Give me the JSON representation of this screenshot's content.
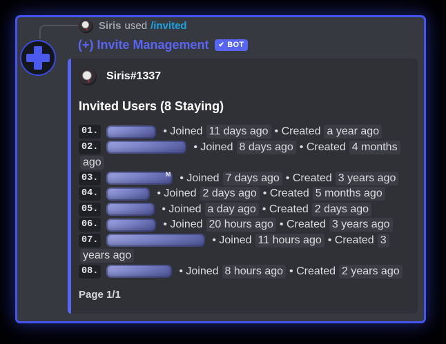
{
  "reply": {
    "username": "Siris",
    "action": "used",
    "command": "/invited"
  },
  "message": {
    "author": "(+) Invite Management",
    "bot_check": "✔",
    "bot_badge": "BOT"
  },
  "embed": {
    "author": "Siris#1337",
    "title": "Invited Users (8 Staying)",
    "footer": "Page 1/1",
    "entries": [
      {
        "num": "01.",
        "pill_width": 72,
        "fragment": "",
        "rows": [
          [
            {
              "t": "txt",
              "v": "• Joined"
            },
            {
              "t": "chip",
              "v": "11 days ago"
            },
            {
              "t": "txt",
              "v": "• Created"
            },
            {
              "t": "chip",
              "v": "a year ago"
            }
          ]
        ]
      },
      {
        "num": "02.",
        "pill_width": 116,
        "fragment": "",
        "rows": [
          [
            {
              "t": "txt",
              "v": "• Joined"
            },
            {
              "t": "chip",
              "v": "8 days ago"
            },
            {
              "t": "txt",
              "v": "• Created"
            },
            {
              "t": "chip",
              "v": "4 months"
            }
          ],
          [
            {
              "t": "chip",
              "v": "ago"
            }
          ]
        ]
      },
      {
        "num": "03.",
        "pill_width": 96,
        "fragment": "M",
        "rows": [
          [
            {
              "t": "txt",
              "v": "• Joined"
            },
            {
              "t": "chip",
              "v": "7 days ago"
            },
            {
              "t": "txt",
              "v": "• Created"
            },
            {
              "t": "chip",
              "v": "3 years ago"
            }
          ]
        ]
      },
      {
        "num": "04.",
        "pill_width": 63,
        "fragment": "",
        "rows": [
          [
            {
              "t": "txt",
              "v": "• Joined"
            },
            {
              "t": "chip",
              "v": "2 days ago"
            },
            {
              "t": "txt",
              "v": "• Created"
            },
            {
              "t": "chip",
              "v": "5 months ago"
            }
          ]
        ]
      },
      {
        "num": "05.",
        "pill_width": 70,
        "fragment": "",
        "rows": [
          [
            {
              "t": "txt",
              "v": "• Joined"
            },
            {
              "t": "chip",
              "v": "a day ago"
            },
            {
              "t": "txt",
              "v": "• Created"
            },
            {
              "t": "chip",
              "v": "2 days ago"
            }
          ]
        ]
      },
      {
        "num": "06.",
        "pill_width": 72,
        "fragment": "",
        "rows": [
          [
            {
              "t": "txt",
              "v": "• Joined"
            },
            {
              "t": "chip",
              "v": "20 hours ago"
            },
            {
              "t": "txt",
              "v": "• Created"
            },
            {
              "t": "chip",
              "v": "3 years ago"
            }
          ]
        ]
      },
      {
        "num": "07.",
        "pill_width": 143,
        "fragment": "",
        "rows": [
          [
            {
              "t": "txt",
              "v": "• Joined"
            },
            {
              "t": "chip",
              "v": "11 hours ago"
            },
            {
              "t": "txt",
              "v": "• Created"
            },
            {
              "t": "chip",
              "v": "3"
            }
          ],
          [
            {
              "t": "chip",
              "v": "years ago"
            }
          ]
        ]
      },
      {
        "num": "08.",
        "pill_width": 95,
        "fragment": "",
        "rows": [
          [
            {
              "t": "txt",
              "v": "• Joined"
            },
            {
              "t": "chip",
              "v": "8 hours ago"
            },
            {
              "t": "txt",
              "v": "• Created"
            },
            {
              "t": "chip",
              "v": "2 years ago"
            }
          ]
        ]
      }
    ]
  },
  "colors": {
    "frame_border": "#4553f0",
    "chat_bg": "#36393f",
    "embed_bg": "#2f3136",
    "accent": "#5865f2",
    "bot_name": "#5b64f3",
    "command": "#1aa6e6",
    "chip_bg": "#3a3d44",
    "code_bg": "#1e2126",
    "text": "#dbdcde"
  }
}
